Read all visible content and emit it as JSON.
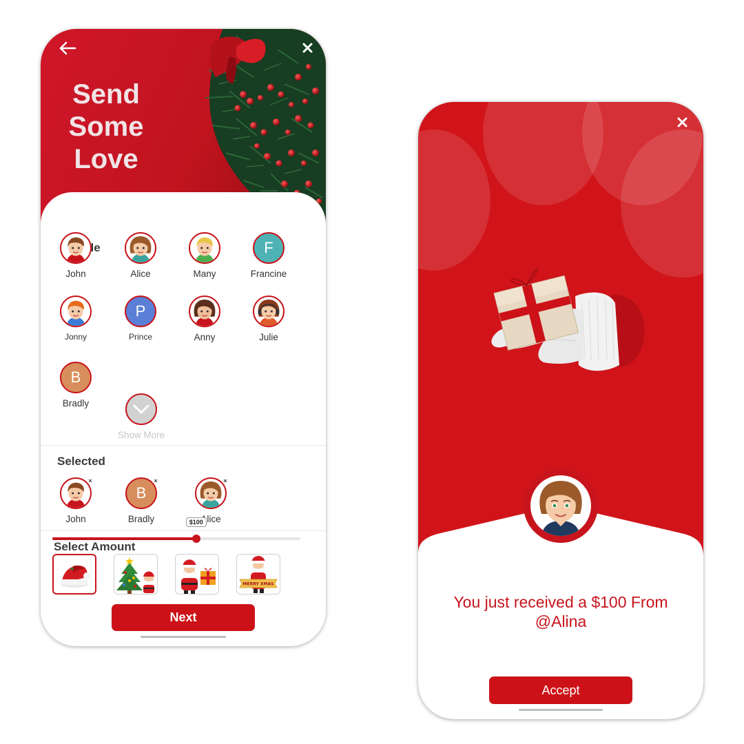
{
  "screen1": {
    "title": "Send\nSome\nLove",
    "people_title": "People",
    "people": [
      {
        "name": "John",
        "type": "face",
        "face": "boy-brown"
      },
      {
        "name": "Alice",
        "type": "face",
        "face": "girl-brown"
      },
      {
        "name": "Many",
        "type": "face",
        "face": "boy-blond"
      },
      {
        "name": "Francine",
        "type": "letter",
        "letter": "F",
        "color": "#4fb3b5"
      },
      {
        "name": "Jonny",
        "type": "face",
        "face": "boy-ginger"
      },
      {
        "name": "Prince",
        "type": "letter",
        "letter": "P",
        "color": "#5b7fd6"
      },
      {
        "name": "Anny",
        "type": "face",
        "face": "girl-dark"
      },
      {
        "name": "Julie",
        "type": "face",
        "face": "girl-headset"
      },
      {
        "name": "Bradly",
        "type": "letter",
        "letter": "B",
        "color": "#d88e5c"
      }
    ],
    "show_more_label": "Show More",
    "selected_title": "Selected",
    "selected": [
      {
        "name": "John",
        "type": "face",
        "face": "boy-brown"
      },
      {
        "name": "Bradly",
        "type": "letter",
        "letter": "B",
        "color": "#d88e5c"
      },
      {
        "name": "Alice",
        "type": "face",
        "face": "girl-brown"
      }
    ],
    "amount_title": "Select Amount",
    "amount_label": "$100",
    "amount_fraction": 0.58,
    "cards": [
      "santa-hat-icon",
      "christmas-tree-santa-icon",
      "santa-gift-icon",
      "santa-merry-xmas-icon"
    ],
    "card_banner_text": "MERRY XMAS",
    "next_label": "Next"
  },
  "screen2": {
    "message": "You just received a $100 From @Alina",
    "accept_label": "Accept"
  },
  "colors": {
    "accent": "#c8141c",
    "hero": "#d0141a"
  }
}
